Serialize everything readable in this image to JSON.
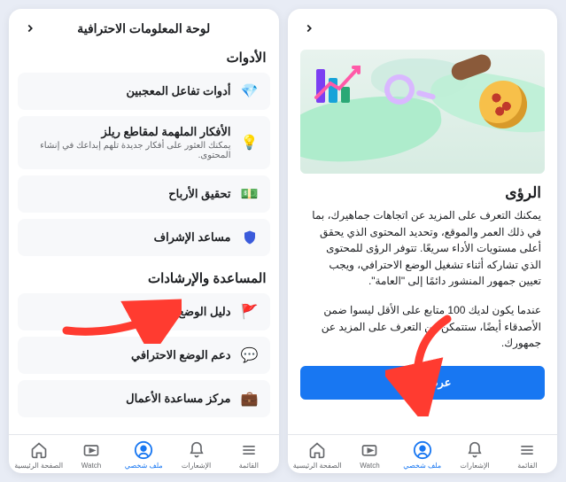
{
  "rightPhone": {
    "headerTitle": "لوحة المعلومات الاحترافية",
    "toolsTitle": "الأدوات",
    "helpTitle": "المساعدة والإرشادات",
    "tools": [
      {
        "label": "أدوات تفاعل المعجبين",
        "sub": ""
      },
      {
        "label": "الأفكار الملهمة لمقاطع ريلز",
        "sub": "يمكنك العثور على أفكار جديدة تلهم إبداعك في إنشاء المحتوى."
      },
      {
        "label": "تحقيق الأرباح",
        "sub": ""
      },
      {
        "label": "مساعد الإشراف",
        "sub": ""
      }
    ],
    "help": [
      {
        "label": "دليل الوضع الاحترافي",
        "sub": ""
      },
      {
        "label": "دعم الوضع الاحترافي",
        "sub": ""
      },
      {
        "label": "مركز مساعدة الأعمال",
        "sub": ""
      }
    ]
  },
  "leftPhone": {
    "insightsTitle": "الرؤى",
    "insightsBody": "يمكنك التعرف على المزيد عن اتجاهات جماهيرك، بما في ذلك العمر والموقع، وتحديد المحتوى الذي يحقق أعلى مستويات الأداء سريعًا. تتوفر الرؤى للمحتوى الذي تشاركه أثناء تشغيل الوضع الاحترافي، ويجب تعيين جمهور المنشور دائمًا إلى \"العامة\".",
    "insightsNote": "عندما يكون لديك 100 متابع على الأقل ليسوا ضمن الأصدقاء أيضًا، ستتمكن من التعرف على المزيد عن جمهورك.",
    "cta": "عرض الرؤى"
  },
  "nav": {
    "items": [
      {
        "key": "menu",
        "label": "القائمة"
      },
      {
        "key": "notifications",
        "label": "الإشعارات"
      },
      {
        "key": "profile",
        "label": "ملف شخصي"
      },
      {
        "key": "watch",
        "label": "Watch"
      },
      {
        "key": "home",
        "label": "الصفحة الرئيسية"
      }
    ],
    "activeKey": "profile"
  },
  "icons": {
    "diamond": "💎",
    "bulb": "💡",
    "money": "💵",
    "shield": "🛡️",
    "flag": "🚩",
    "chat": "💬",
    "briefcase": "💼"
  },
  "colors": {
    "primary": "#1877f2",
    "arrow": "#ff3b30"
  }
}
